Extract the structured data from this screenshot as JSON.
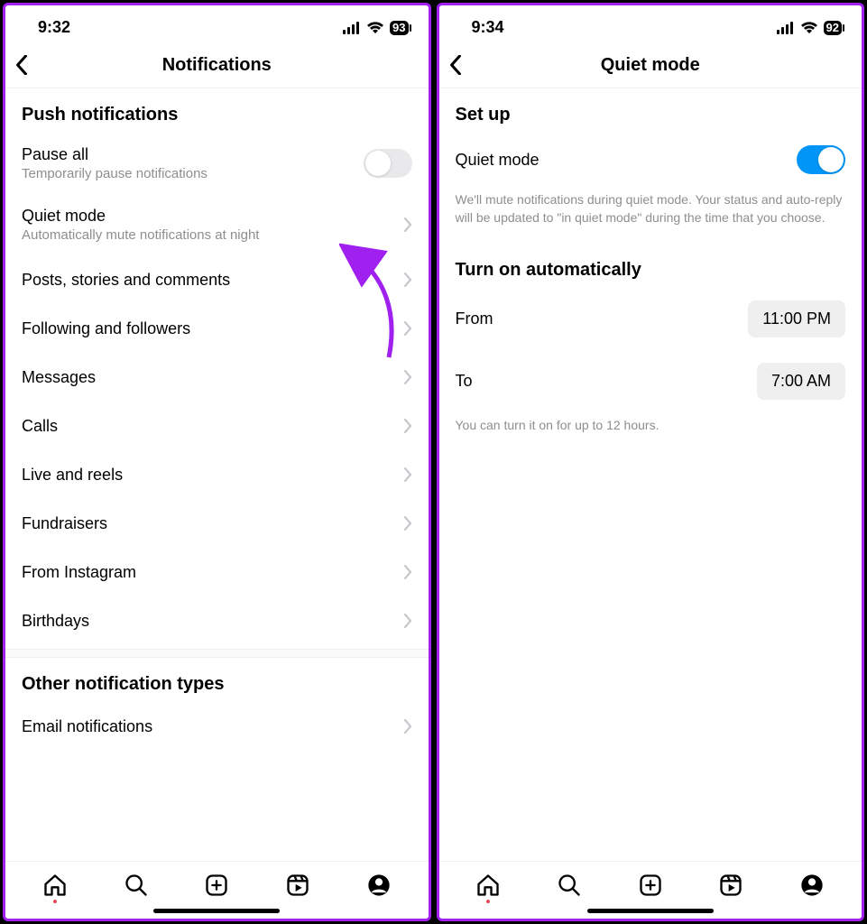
{
  "left": {
    "status": {
      "time": "9:32",
      "battery": "93"
    },
    "header": {
      "title": "Notifications"
    },
    "section1_title": "Push notifications",
    "pause_all": {
      "label": "Pause all",
      "sub": "Temporarily pause notifications"
    },
    "quiet_mode": {
      "label": "Quiet mode",
      "sub": "Automatically mute notifications at night"
    },
    "rows": [
      {
        "label": "Posts, stories and comments"
      },
      {
        "label": "Following and followers"
      },
      {
        "label": "Messages"
      },
      {
        "label": "Calls"
      },
      {
        "label": "Live and reels"
      },
      {
        "label": "Fundraisers"
      },
      {
        "label": "From Instagram"
      },
      {
        "label": "Birthdays"
      }
    ],
    "section2_title": "Other notification types",
    "rows2": [
      {
        "label": "Email notifications"
      }
    ]
  },
  "right": {
    "status": {
      "time": "9:34",
      "battery": "92"
    },
    "header": {
      "title": "Quiet mode"
    },
    "setup_title": "Set up",
    "quiet_label": "Quiet mode",
    "desc": "We'll mute notifications during quiet mode. Your status and auto-reply will be updated to \"in quiet mode\" during the time that you choose.",
    "auto_title": "Turn on automatically",
    "from_label": "From",
    "from_value": "11:00 PM",
    "to_label": "To",
    "to_value": "7:00 AM",
    "limit_note": "You can turn it on for up to 12 hours."
  }
}
